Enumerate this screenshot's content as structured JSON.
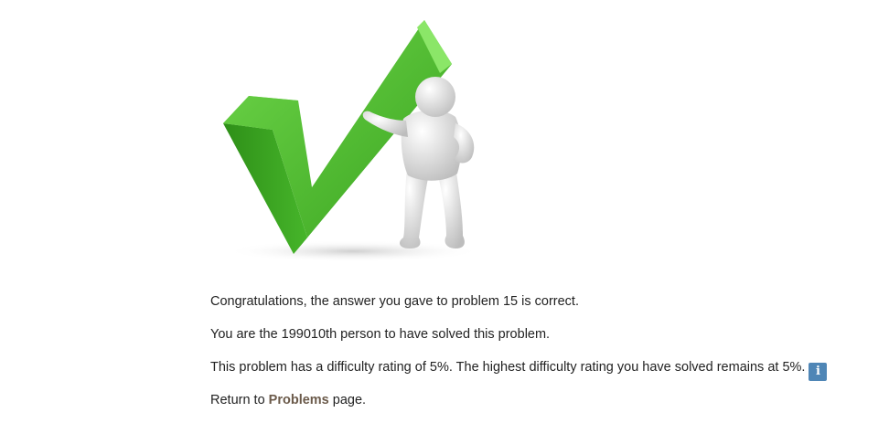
{
  "illustration": {
    "icon": "checkmark-with-figure-icon",
    "check_color": "#4cbb2e"
  },
  "messages": {
    "congratulations": "Congratulations, the answer you gave to problem 15 is correct.",
    "solver_rank": "You are the 199010th person to have solved this problem.",
    "difficulty": "This problem has a difficulty rating of 5%. The highest difficulty rating you have solved remains at 5%.",
    "info_button_label": "i",
    "return_prefix": "Return to ",
    "problems_link": "Problems",
    "return_suffix": " page."
  }
}
